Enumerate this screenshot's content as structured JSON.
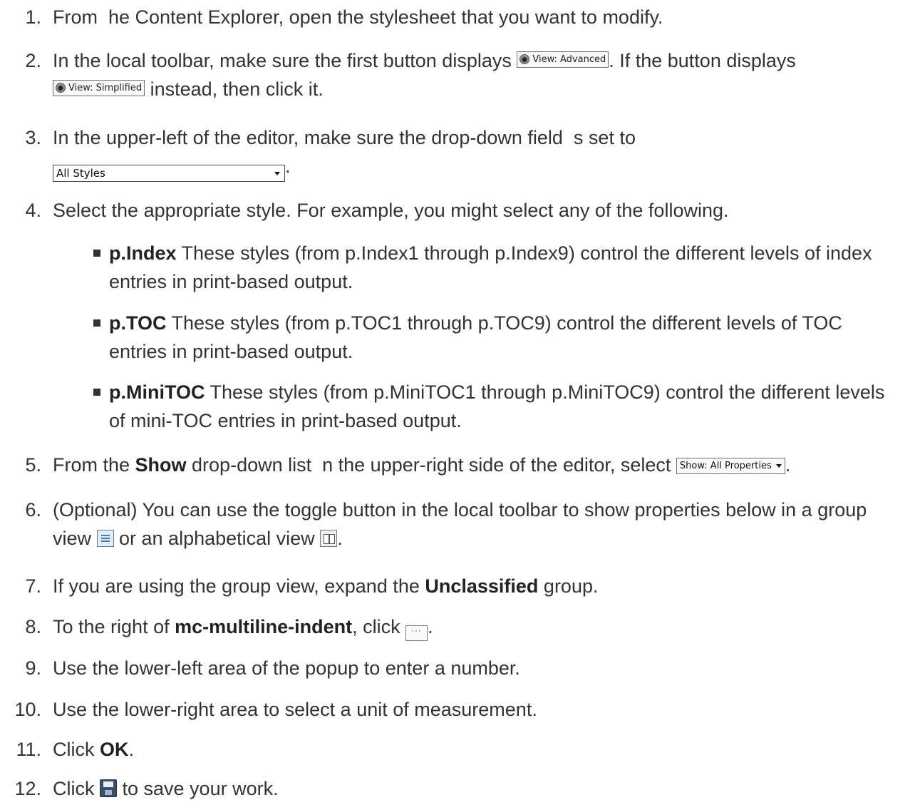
{
  "steps": [
    {
      "num": "1.",
      "text": "From  he Content Explorer, open the stylesheet that you want to modify."
    },
    {
      "num": "2.",
      "pre": "In the local toolbar, make sure the first button displays ",
      "button1": "View: Advanced",
      "mid": ". If the button displays",
      "button2": "View: Simplified",
      "post": " instead, then click it."
    },
    {
      "num": "3.",
      "pre": "In the upper-left of the editor, make sure the drop-down field  s set to",
      "dropdown_value": "All Styles",
      "post": "."
    },
    {
      "num": "4.",
      "text": "Select the appropriate style. For example, you might select any of the following."
    },
    {
      "num": "5.",
      "pre": "From the ",
      "bold": "Show",
      "mid": " drop-down list  n the upper-right side of the editor, select ",
      "button": "Show: All Properties",
      "post": "."
    },
    {
      "num": "6.",
      "pre": "(Optional) You can use the toggle button in the local toolbar to show properties below in a group view ",
      "mid": " or an alphabetical view ",
      "post": "."
    },
    {
      "num": "7.",
      "pre": "If you are using the group view, expand the ",
      "bold": "Unclassified",
      "post": " group."
    },
    {
      "num": "8.",
      "pre": "To the right of ",
      "bold": "mc-multiline-indent",
      "mid": ", click ",
      "button": "···",
      "post": "."
    },
    {
      "num": "9.",
      "text": "Use the lower-left area of the popup to enter a number."
    },
    {
      "num": "10.",
      "text": "Use the lower-right area to select a unit of measurement."
    },
    {
      "num": "11.",
      "pre": "Click ",
      "bold": "OK",
      "post": "."
    },
    {
      "num": "12.",
      "pre": "Click ",
      "post": " to save your work."
    }
  ],
  "bullets": [
    {
      "bold": "p.Index",
      "text": " These styles (from p.Index1 through p.Index9) control the different levels of index entries in print-based output."
    },
    {
      "bold": "p.TOC",
      "text": " These styles (from p.TOC1 through p.TOC9) control the different levels of TOC entries in print-based output."
    },
    {
      "bold": "p.MiniTOC",
      "text": " These styles (from p.MiniTOC1 through p.MiniTOC9) control the different levels of mini-TOC entries in print-based output."
    }
  ],
  "icons": [
    "eye-icon",
    "group-view-icon",
    "alphabetical-view-icon",
    "ellipsis-button",
    "save-icon"
  ]
}
